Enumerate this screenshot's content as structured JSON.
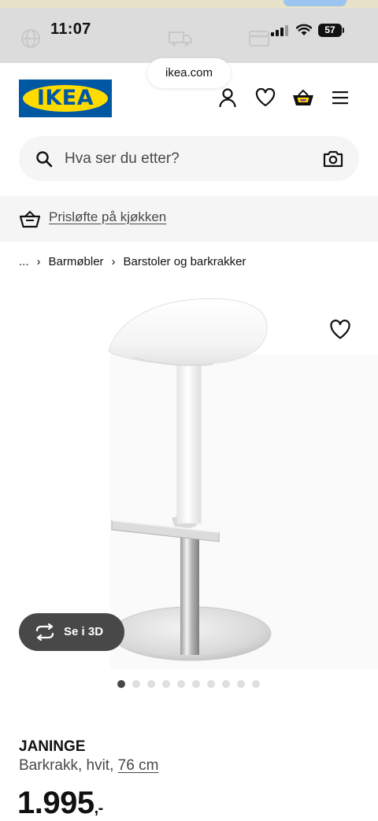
{
  "status_bar": {
    "time": "11:07",
    "battery": "57"
  },
  "browser": {
    "url": "ikea.com"
  },
  "header": {
    "logo_text": "IKEA",
    "icons": [
      "person-icon",
      "heart-icon",
      "basket-icon",
      "menu-icon"
    ]
  },
  "search": {
    "placeholder": "Hva ser du etter?"
  },
  "promo": {
    "label": "Prisløfte på kjøkken"
  },
  "breadcrumb": {
    "items": [
      "...",
      "Barmøbler",
      "Barstoler og barkrakker"
    ]
  },
  "gallery": {
    "view_3d_label": "Se i 3D",
    "image_count": 10,
    "active_index": 0
  },
  "product": {
    "name": "JANINGE",
    "description": "Barkrakk, hvit,",
    "size": "76 cm",
    "price": "1.995",
    "price_suffix": ",-"
  },
  "colors": {
    "ikea_blue": "#0058a3",
    "ikea_yellow": "#ffdb00",
    "text_primary": "#111111",
    "text_secondary": "#484848",
    "surface": "#f5f5f5"
  }
}
